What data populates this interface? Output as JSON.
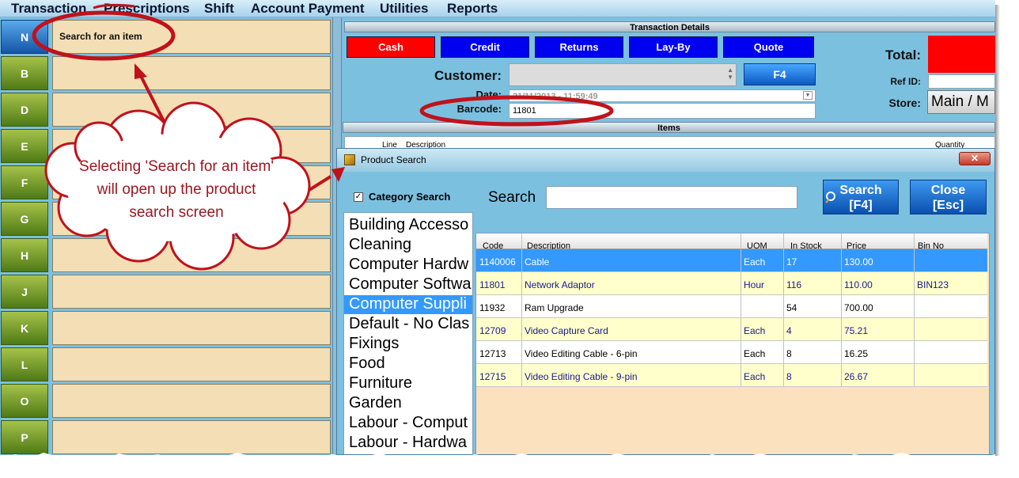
{
  "menu": [
    "Transaction",
    "Prescriptions",
    "Shift",
    "Account Payment",
    "Utilities",
    "Reports"
  ],
  "letters": [
    "N",
    "B",
    "D",
    "E",
    "F",
    "G",
    "H",
    "J",
    "K",
    "L",
    "O",
    "P"
  ],
  "left_items": {
    "first_item": "Search for an item"
  },
  "transaction_details": {
    "title": "Transaction Details",
    "buttons": [
      "Cash",
      "Credit",
      "Returns",
      "Lay-By",
      "Quote"
    ],
    "customer_label": "Customer:",
    "customer_lookup_button": "F4",
    "date_label": "Date:",
    "date_value": "21/11/2013 - 11:59:49",
    "barcode_label": "Barcode:",
    "barcode_value": "11801",
    "total_label": "Total:",
    "ref_id_label": "Ref ID:",
    "store_label": "Store:",
    "store_value": "Main / M"
  },
  "items_panel": {
    "title": "Items",
    "columns": [
      "Line",
      "Description",
      "Quantity"
    ]
  },
  "product_search": {
    "window_title": "Product Search",
    "category_search_label": "Category Search",
    "category_search_checked": true,
    "search_label": "Search",
    "search_value": "",
    "search_button": [
      "Search",
      "[F4]"
    ],
    "close_button": [
      "Close",
      "[Esc]"
    ],
    "categories": [
      "Building Accesso",
      "Cleaning",
      "Computer Hardw",
      "Computer Softwa",
      "Computer Suppli",
      "Default - No Clas",
      "Fixings",
      "Food",
      "Furniture",
      "Garden",
      "Labour - Comput",
      "Labour - Hardwa"
    ],
    "selected_category_index": 4,
    "columns": [
      "Code",
      "Description",
      "UOM",
      "In Stock",
      "Price",
      "Bin No"
    ],
    "rows": [
      [
        "1140006",
        "Cable",
        "Each",
        "17",
        "130.00",
        ""
      ],
      [
        "11801",
        "Network Adaptor",
        "Hour",
        "116",
        "110.00",
        "BIN123"
      ],
      [
        "11932",
        "Ram Upgrade",
        "",
        "54",
        "700.00",
        ""
      ],
      [
        "12709",
        "Video Capture Card",
        "Each",
        "4",
        "75.21",
        ""
      ],
      [
        "12713",
        "Video Editing Cable - 6-pin",
        "Each",
        "8",
        "16.25",
        ""
      ],
      [
        "12715",
        "Video Editing Cable - 9-pin",
        "Each",
        "8",
        "26.67",
        ""
      ]
    ],
    "selected_row_index": 0
  },
  "annotation": {
    "callout_text": "Selecting 'Search for an item' will open up the product search screen"
  },
  "colors": {
    "cash": "#ff0000",
    "tx_buttons": "#0000f0",
    "selection": "#3399ff",
    "row_alt": "#ffffcc",
    "cell_bg": "#f4deb5",
    "callout": "#c0121b"
  }
}
